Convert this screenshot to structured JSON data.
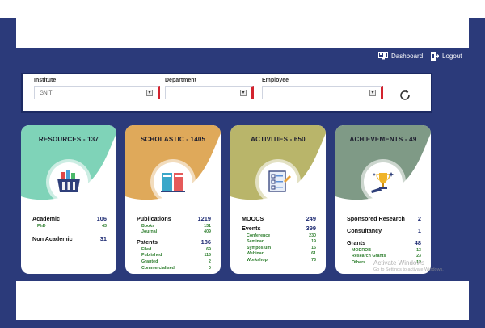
{
  "nav": {
    "dashboard_label": "Dashboard",
    "logout_label": "Logout"
  },
  "filters": {
    "institute": {
      "label": "Institute",
      "value": "GNIT"
    },
    "department": {
      "label": "Department",
      "value": ""
    },
    "employee": {
      "label": "Employee",
      "value": ""
    }
  },
  "cards": [
    {
      "title": "RESOURCES - 137",
      "icon": "basket-icon",
      "color": "#7fd3b8",
      "rows": [
        {
          "label": "Academic",
          "value": "106",
          "level": "main"
        },
        {
          "label": "PhD",
          "value": "43",
          "level": "sub"
        },
        {
          "label": "Non Academic",
          "value": "31",
          "level": "main"
        }
      ]
    },
    {
      "title": "SCHOLASTIC - 1405",
      "icon": "books-icon",
      "color": "#dfa95a",
      "rows": [
        {
          "label": "Publications",
          "value": "1219",
          "level": "main"
        },
        {
          "label": "Books",
          "value": "131",
          "level": "sub"
        },
        {
          "label": "Journal",
          "value": "409",
          "level": "sub"
        },
        {
          "label": "Patents",
          "value": "186",
          "level": "main"
        },
        {
          "label": "Filed",
          "value": "69",
          "level": "sub"
        },
        {
          "label": "Published",
          "value": "115",
          "level": "sub"
        },
        {
          "label": "Granted",
          "value": "2",
          "level": "sub"
        },
        {
          "label": "Commercialised",
          "value": "0",
          "level": "sub"
        }
      ]
    },
    {
      "title": "ACTIVITIES - 650",
      "icon": "checklist-icon",
      "color": "#b9b56a",
      "rows": [
        {
          "label": "MOOCS",
          "value": "249",
          "level": "main"
        },
        {
          "label": "Events",
          "value": "399",
          "level": "main"
        },
        {
          "label": "Conference",
          "value": "230",
          "level": "sub"
        },
        {
          "label": "Seminar",
          "value": "19",
          "level": "sub"
        },
        {
          "label": "Symposium",
          "value": "16",
          "level": "sub"
        },
        {
          "label": "Webinar",
          "value": "61",
          "level": "sub"
        },
        {
          "label": "Workshop",
          "value": "73",
          "level": "sub"
        }
      ]
    },
    {
      "title": "ACHIEVEMENTS - 49",
      "icon": "trophy-icon",
      "color": "#7f9a86",
      "rows": [
        {
          "label": "Sponsored Research",
          "value": "2",
          "level": "main"
        },
        {
          "label": "Consultancy",
          "value": "1",
          "level": "main"
        },
        {
          "label": "Grants",
          "value": "48",
          "level": "main"
        },
        {
          "label": "MODROB",
          "value": "13",
          "level": "sub"
        },
        {
          "label": "Research Grants",
          "value": "23",
          "level": "sub"
        },
        {
          "label": "Others",
          "value": "12",
          "level": "sub"
        }
      ]
    }
  ],
  "watermark": {
    "line1": "Activate Windows",
    "line2": "Go to Settings to activate Windows."
  }
}
